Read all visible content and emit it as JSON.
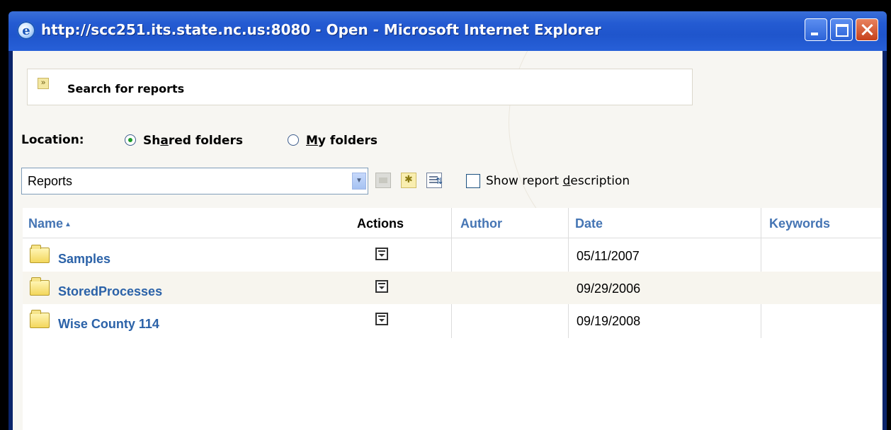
{
  "window": {
    "title": "http://scc251.its.state.nc.us:8080 - Open - Microsoft Internet Explorer",
    "app_icon": "ie-icon",
    "controls": [
      "minimize-icon",
      "maximize-icon",
      "close-icon"
    ]
  },
  "search": {
    "label": "Search for reports",
    "icon": "expand-icon"
  },
  "location": {
    "label": "Location:",
    "options": [
      {
        "label_pre": "Sh",
        "label_u": "a",
        "label_post": "red folders",
        "checked": true
      },
      {
        "label_pre": "",
        "label_u": "M",
        "label_post": "y folders",
        "checked": false
      }
    ]
  },
  "folder_select": {
    "value": "Reports"
  },
  "toolbar": {
    "icons": [
      "up-folder-icon",
      "new-folder-icon",
      "refresh-icon"
    ],
    "show_description": {
      "label_pre": "Show report ",
      "label_u": "d",
      "label_post": "escription",
      "checked": false
    }
  },
  "table": {
    "headers": {
      "name": "Name",
      "actions": "Actions",
      "author": "Author",
      "date": "Date",
      "keywords": "Keywords"
    },
    "rows": [
      {
        "name": "Samples",
        "author": "",
        "date": "05/11/2007",
        "keywords": ""
      },
      {
        "name": "StoredProcesses",
        "author": "",
        "date": "09/29/2006",
        "keywords": ""
      },
      {
        "name": "Wise County 114",
        "author": "",
        "date": "09/19/2008",
        "keywords": ""
      }
    ]
  },
  "colors": {
    "titlebar": "#245bd2",
    "link_blue": "#2b62a8",
    "header_blue": "#4575b4",
    "radio_checked": "#1e9b2c"
  }
}
